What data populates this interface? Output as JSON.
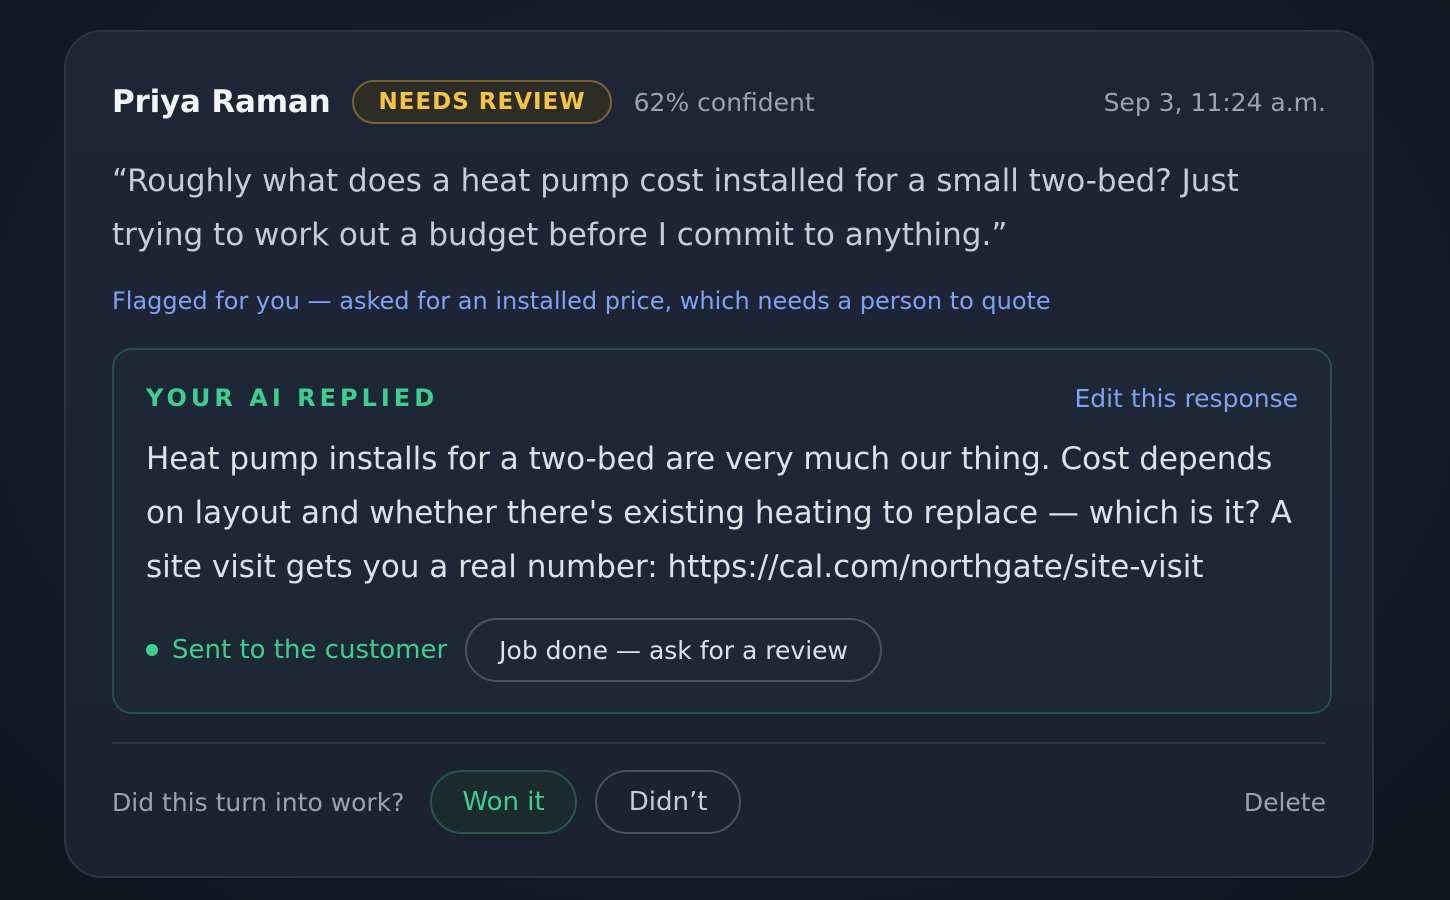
{
  "lead": {
    "name": "Priya Raman",
    "status_badge": "NEEDS REVIEW",
    "confidence": "62% confident",
    "timestamp": "Sep 3, 11:24 a.m.",
    "message": "“Roughly what does a heat pump cost installed for a small two-bed? Just trying to work out a budget before I commit to anything.”",
    "flag_note": "Flagged for you — asked for an installed price, which needs a person to quote"
  },
  "ai_reply": {
    "label": "YOUR AI REPLIED",
    "edit_label": "Edit this response",
    "text": "Heat pump installs for a two-bed are very much our thing. Cost depends on layout and whether there's existing heating to replace — which is it? A site visit gets you a real number: https://cal.com/northgate/site-visit",
    "sent_status": "Sent to the customer",
    "followup_button": "Job done — ask for a review"
  },
  "outcome": {
    "question": "Did this turn into work?",
    "won_label": "Won it",
    "didnt_label": "Didn’t",
    "delete_label": "Delete"
  },
  "colors": {
    "accent_green": "#3ecf8e",
    "accent_blue": "#7fa2f2",
    "badge_amber": "#f4c542",
    "card_bg": "#1e2536"
  }
}
